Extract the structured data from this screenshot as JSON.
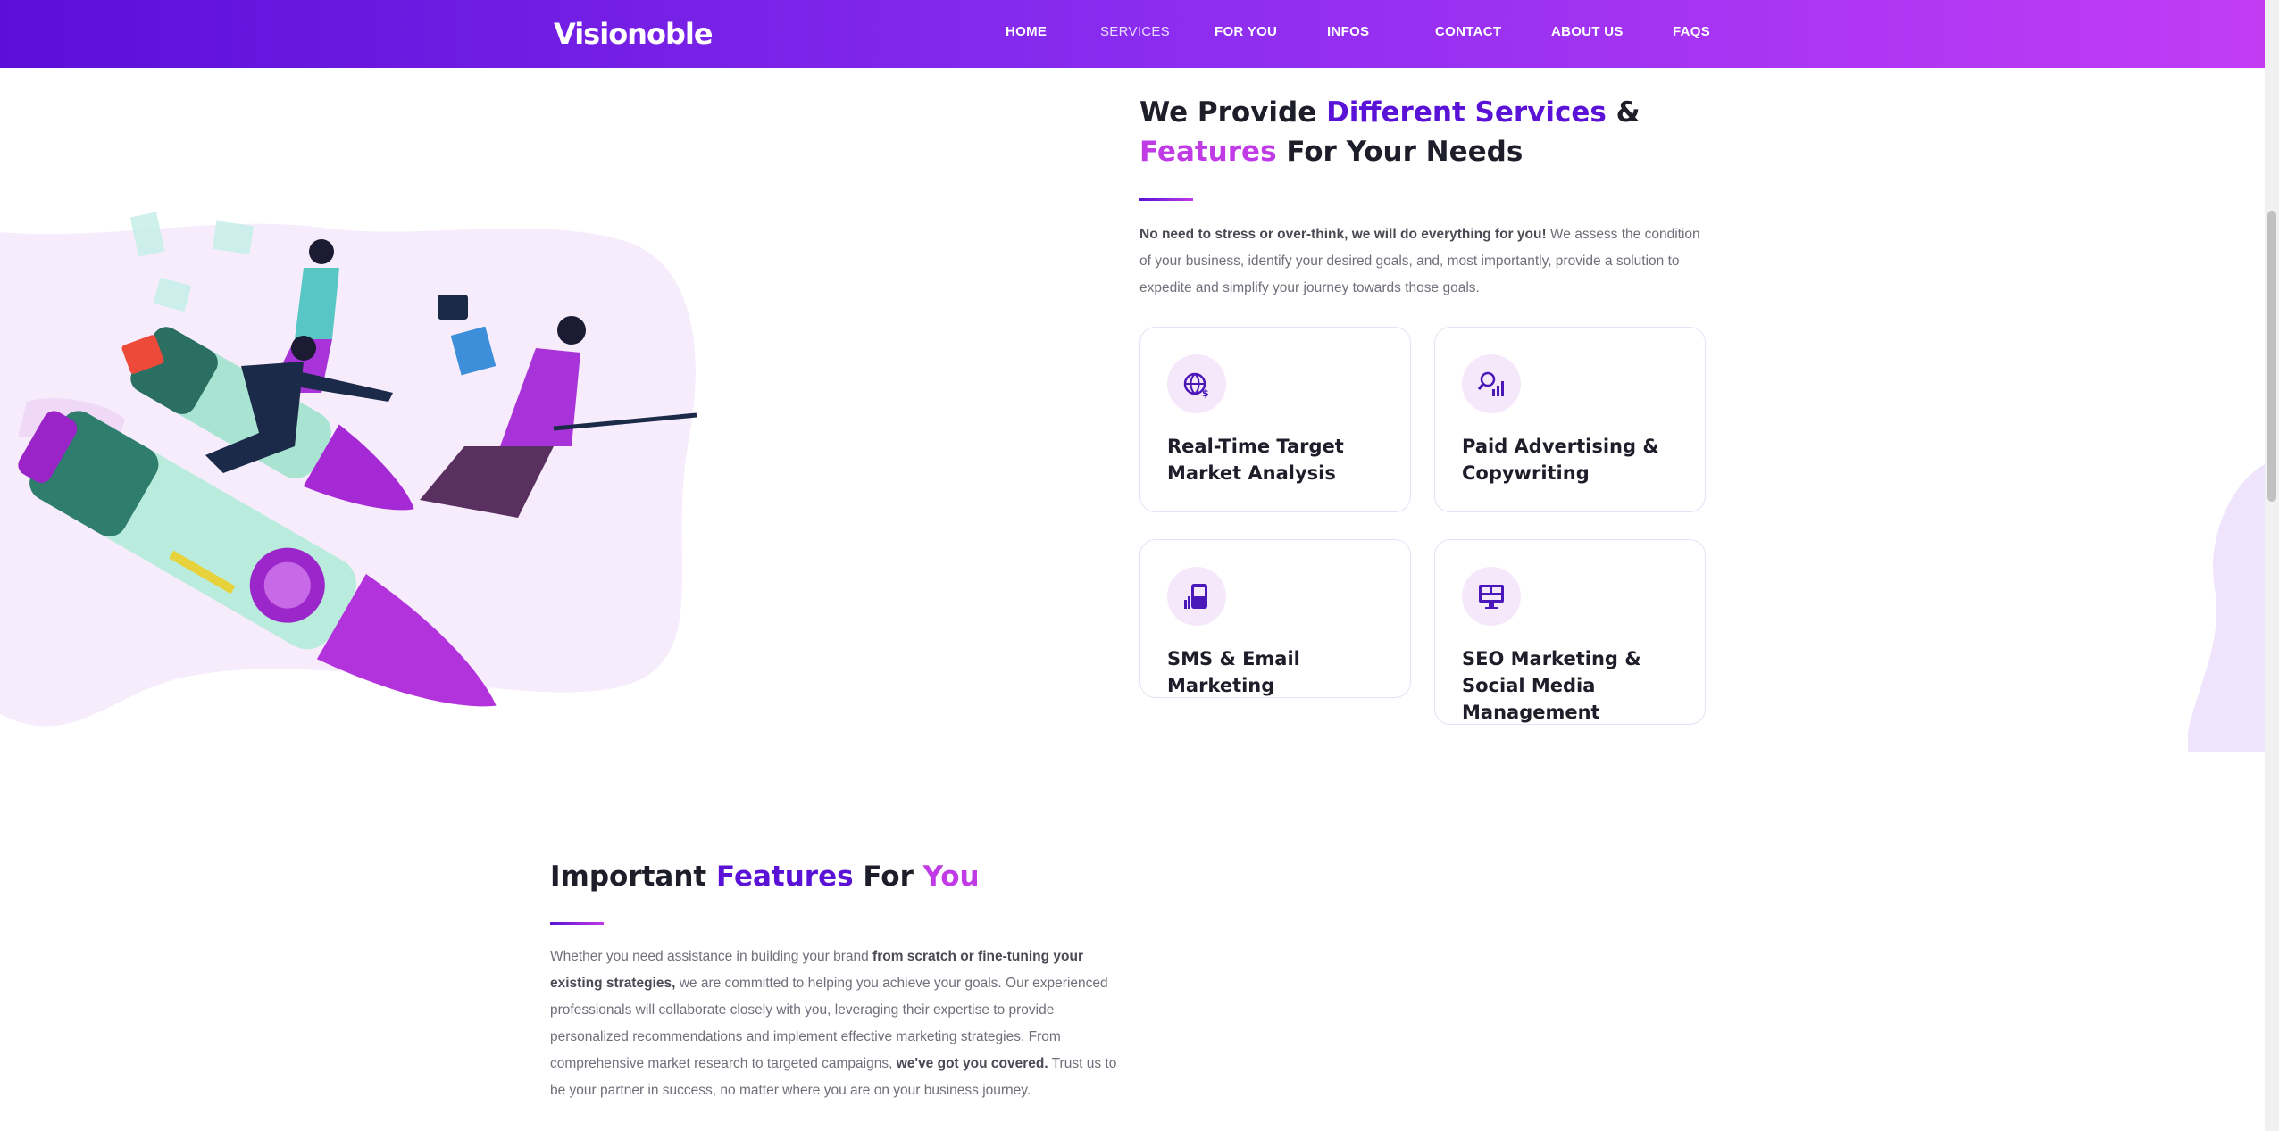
{
  "nav": {
    "logo": "Visionoble",
    "items": [
      {
        "label": "HOME",
        "active": false
      },
      {
        "label": "SERVICES",
        "active": true
      },
      {
        "label": "FOR YOU",
        "active": false
      },
      {
        "label": "INFOS",
        "active": false
      },
      {
        "label": "CONTACT",
        "active": false
      },
      {
        "label": "ABOUT US",
        "active": false
      },
      {
        "label": "FAQS",
        "active": false
      }
    ]
  },
  "services": {
    "title_a": "We Provide ",
    "title_b": "Different Services",
    "title_c": " &",
    "title_d": "Features",
    "title_e": " For Your Needs",
    "lead_bold": "No need to stress or over-think, we will do everything for you!",
    "lead_text": " We assess the condition of your business, identify your desired goals, and, most importantly, provide a solution to expedite and simplify your journey towards those goals.",
    "cards": [
      {
        "label": "Real-Time Target Market Analysis",
        "icon": "globe-dollar-icon"
      },
      {
        "label": "Paid Advertising & Copywriting",
        "icon": "search-chart-icon"
      },
      {
        "label": "SMS & Email Marketing",
        "icon": "phone-chart-icon"
      },
      {
        "label": "SEO Marketing & Social Media Management",
        "icon": "monitor-dashboard-icon"
      }
    ]
  },
  "features": {
    "title_a": "Important ",
    "title_b": "Features",
    "title_c": " For ",
    "title_d": "You",
    "body_1": "Whether you need assistance in building your brand ",
    "body_2": "from scratch or fine-tuning your existing strategies,",
    "body_3": " we are committed to helping you achieve your goals. Our experienced professionals will collaborate closely with you, leveraging their expertise to provide personalized recommendations and implement effective marketing strategies. From comprehensive market research to targeted campaigns, ",
    "body_4": "we've got you covered.",
    "body_5": " Trust us to be your partner in success, no matter where you are on your business journey."
  },
  "colors": {
    "nav_start": "#5b0fd8",
    "nav_end": "#c23cf4",
    "accent_purple": "#5a12d6",
    "accent_pink": "#c03ae6"
  }
}
